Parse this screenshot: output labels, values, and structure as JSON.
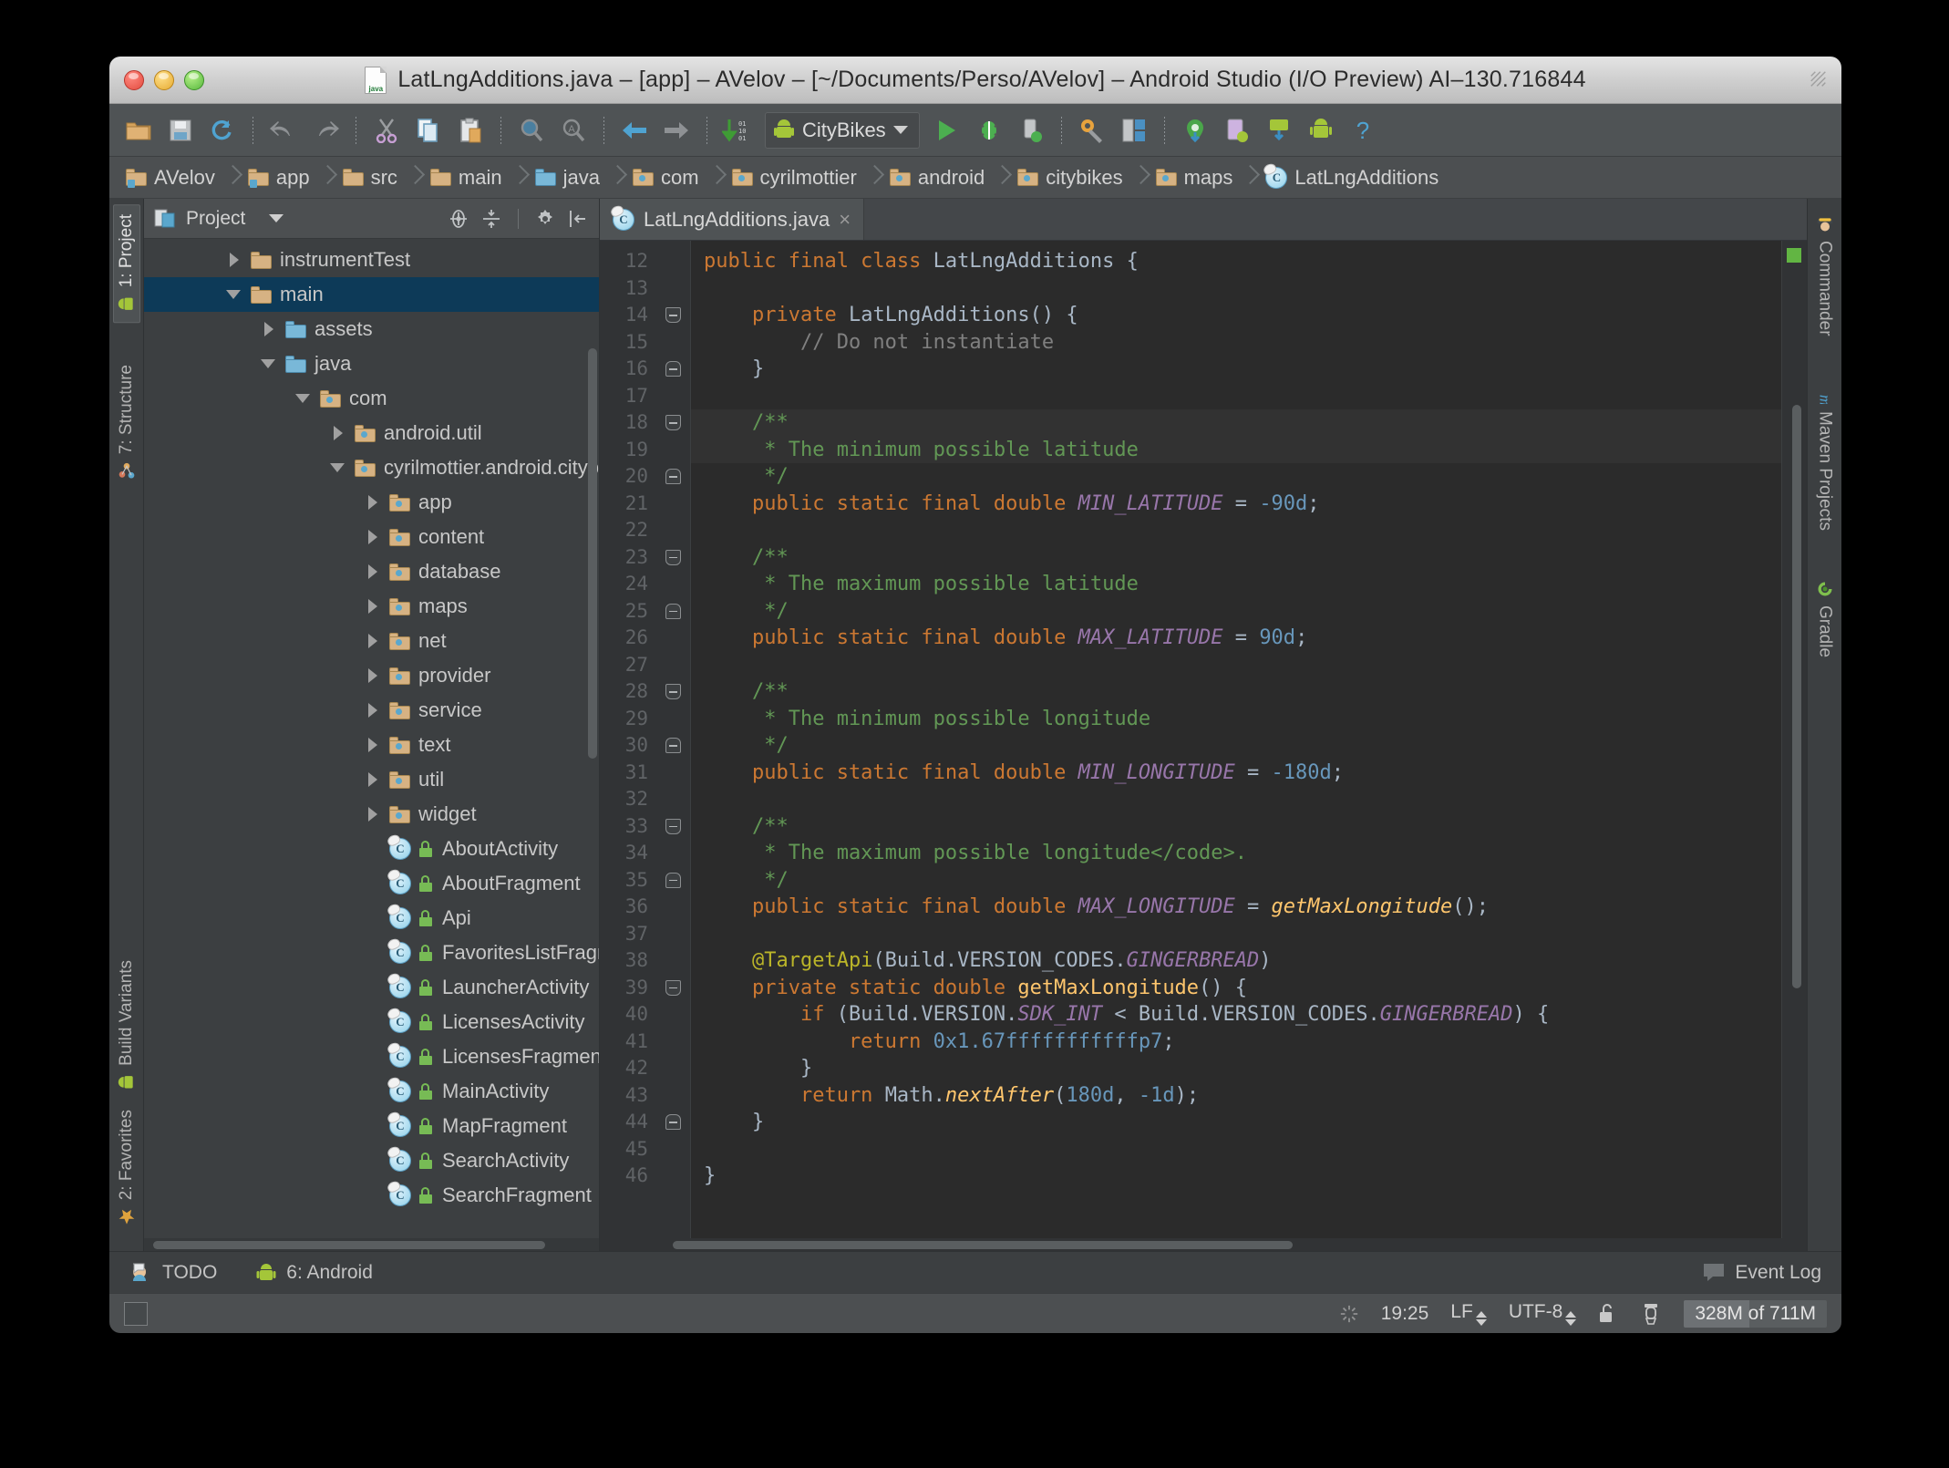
{
  "window": {
    "title": "LatLngAdditions.java – [app] – AVelov – [~/Documents/Perso/AVelov] – Android Studio (I/O Preview) AI–130.716844",
    "file_icon": "java-file-icon"
  },
  "toolbar": {
    "buttons": [
      {
        "name": "open-folder-icon"
      },
      {
        "name": "save-all-icon"
      },
      {
        "name": "sync-refresh-icon"
      },
      {
        "name": "separator"
      },
      {
        "name": "undo-icon"
      },
      {
        "name": "redo-icon"
      },
      {
        "name": "separator"
      },
      {
        "name": "cut-icon"
      },
      {
        "name": "copy-icon"
      },
      {
        "name": "paste-icon"
      },
      {
        "name": "separator"
      },
      {
        "name": "find-icon"
      },
      {
        "name": "replace-icon"
      },
      {
        "name": "separator"
      },
      {
        "name": "back-icon"
      },
      {
        "name": "forward-icon"
      },
      {
        "name": "separator"
      },
      {
        "name": "compile-icon"
      }
    ],
    "run_config": "CityBikes",
    "right_buttons": [
      {
        "name": "run-icon"
      },
      {
        "name": "debug-icon"
      },
      {
        "name": "attach-debugger-icon"
      },
      {
        "name": "separator"
      },
      {
        "name": "settings-wrench-icon"
      },
      {
        "name": "project-structure-icon"
      },
      {
        "name": "separator"
      },
      {
        "name": "sdk-location-icon"
      },
      {
        "name": "avd-manager-icon"
      },
      {
        "name": "sdk-manager-icon"
      },
      {
        "name": "android-icon"
      },
      {
        "name": "help-icon"
      }
    ]
  },
  "breadcrumbs": [
    {
      "label": "AVelov",
      "icon": "folder-source-icon"
    },
    {
      "label": "app",
      "icon": "folder-source-icon"
    },
    {
      "label": "src",
      "icon": "folder-icon"
    },
    {
      "label": "main",
      "icon": "folder-icon"
    },
    {
      "label": "java",
      "icon": "folder-blue-icon"
    },
    {
      "label": "com",
      "icon": "folder-package-icon"
    },
    {
      "label": "cyrilmottier",
      "icon": "folder-package-icon"
    },
    {
      "label": "android",
      "icon": "folder-package-icon"
    },
    {
      "label": "citybikes",
      "icon": "folder-package-icon"
    },
    {
      "label": "maps",
      "icon": "folder-package-icon"
    },
    {
      "label": "LatLngAdditions",
      "icon": "class-icon"
    }
  ],
  "left_strip": [
    {
      "label": "1: Project",
      "icon": "android-icon",
      "selected": true
    },
    {
      "label": "7: Structure",
      "icon": "structure-icon",
      "selected": false
    },
    {
      "label": "Build Variants",
      "icon": "android-icon",
      "selected": false
    },
    {
      "label": "2: Favorites",
      "icon": "star-icon",
      "selected": false
    }
  ],
  "right_strip": [
    {
      "label": "Commander",
      "icon": "commander-icon"
    },
    {
      "label": "Maven Projects",
      "icon": "maven-icon"
    },
    {
      "label": "Gradle",
      "icon": "gradle-icon"
    }
  ],
  "project_panel": {
    "title": "Project",
    "title_icon": "project-view-icon",
    "actions": [
      {
        "name": "scroll-from-source-icon"
      },
      {
        "name": "collapse-all-icon"
      },
      {
        "name": "settings-gear-icon"
      },
      {
        "name": "hide-panel-icon"
      }
    ],
    "tree": [
      {
        "label": "instrumentTest",
        "indent": 2,
        "state": "closed",
        "icon": "folder-icon",
        "selected": false
      },
      {
        "label": "main",
        "indent": 2,
        "state": "open",
        "icon": "folder-icon",
        "selected": true
      },
      {
        "label": "assets",
        "indent": 3,
        "state": "closed",
        "icon": "folder-blue-icon",
        "selected": false
      },
      {
        "label": "java",
        "indent": 3,
        "state": "open",
        "icon": "folder-blue-icon",
        "selected": false
      },
      {
        "label": "com",
        "indent": 4,
        "state": "open",
        "icon": "folder-package-icon",
        "selected": false
      },
      {
        "label": "android.util",
        "indent": 5,
        "state": "closed",
        "icon": "folder-package-icon",
        "selected": false
      },
      {
        "label": "cyrilmottier.android.citybikes",
        "indent": 5,
        "state": "open",
        "icon": "folder-package-icon",
        "selected": false
      },
      {
        "label": "app",
        "indent": 6,
        "state": "closed",
        "icon": "folder-package-icon",
        "selected": false
      },
      {
        "label": "content",
        "indent": 6,
        "state": "closed",
        "icon": "folder-package-icon",
        "selected": false
      },
      {
        "label": "database",
        "indent": 6,
        "state": "closed",
        "icon": "folder-package-icon",
        "selected": false
      },
      {
        "label": "maps",
        "indent": 6,
        "state": "closed",
        "icon": "folder-package-icon",
        "selected": false
      },
      {
        "label": "net",
        "indent": 6,
        "state": "closed",
        "icon": "folder-package-icon",
        "selected": false
      },
      {
        "label": "provider",
        "indent": 6,
        "state": "closed",
        "icon": "folder-package-icon",
        "selected": false
      },
      {
        "label": "service",
        "indent": 6,
        "state": "closed",
        "icon": "folder-package-icon",
        "selected": false
      },
      {
        "label": "text",
        "indent": 6,
        "state": "closed",
        "icon": "folder-package-icon",
        "selected": false
      },
      {
        "label": "util",
        "indent": 6,
        "state": "closed",
        "icon": "folder-package-icon",
        "selected": false
      },
      {
        "label": "widget",
        "indent": 6,
        "state": "closed",
        "icon": "folder-package-icon",
        "selected": false
      },
      {
        "label": "AboutActivity",
        "indent": 6,
        "state": "none",
        "icon": "class-icon",
        "selected": false
      },
      {
        "label": "AboutFragment",
        "indent": 6,
        "state": "none",
        "icon": "class-icon",
        "selected": false
      },
      {
        "label": "Api",
        "indent": 6,
        "state": "none",
        "icon": "class-icon",
        "selected": false
      },
      {
        "label": "FavoritesListFragment",
        "indent": 6,
        "state": "none",
        "icon": "class-icon",
        "selected": false
      },
      {
        "label": "LauncherActivity",
        "indent": 6,
        "state": "none",
        "icon": "class-icon",
        "selected": false
      },
      {
        "label": "LicensesActivity",
        "indent": 6,
        "state": "none",
        "icon": "class-icon",
        "selected": false
      },
      {
        "label": "LicensesFragment",
        "indent": 6,
        "state": "none",
        "icon": "class-icon",
        "selected": false
      },
      {
        "label": "MainActivity",
        "indent": 6,
        "state": "none",
        "icon": "class-icon",
        "selected": false
      },
      {
        "label": "MapFragment",
        "indent": 6,
        "state": "none",
        "icon": "class-icon",
        "selected": false
      },
      {
        "label": "SearchActivity",
        "indent": 6,
        "state": "none",
        "icon": "class-icon",
        "selected": false
      },
      {
        "label": "SearchFragment",
        "indent": 6,
        "state": "none",
        "icon": "class-icon",
        "selected": false
      }
    ]
  },
  "editor": {
    "tab": {
      "label": "LatLngAdditions.java",
      "icon": "class-icon",
      "close": "×"
    },
    "first_line": 12,
    "lines": [
      {
        "n": 12,
        "fold": "none",
        "hl": false,
        "tokens": [
          {
            "t": "public final class ",
            "c": "kw"
          },
          {
            "t": "LatLngAdditions {",
            "c": "cls"
          }
        ]
      },
      {
        "n": 13,
        "fold": "none",
        "hl": false,
        "tokens": []
      },
      {
        "n": 14,
        "fold": "collapse",
        "hl": false,
        "tokens": [
          {
            "t": "    ",
            "c": "cls"
          },
          {
            "t": "private ",
            "c": "kw"
          },
          {
            "t": "LatLngAdditions() {",
            "c": "cls"
          }
        ]
      },
      {
        "n": 15,
        "fold": "none",
        "hl": false,
        "tokens": [
          {
            "t": "        // Do not instantiate",
            "c": "cmt"
          }
        ]
      },
      {
        "n": 16,
        "fold": "expandtop",
        "hl": false,
        "tokens": [
          {
            "t": "    }",
            "c": "cls"
          }
        ]
      },
      {
        "n": 17,
        "fold": "none",
        "hl": false,
        "tokens": []
      },
      {
        "n": 18,
        "fold": "collapse",
        "hl": true,
        "tokens": [
          {
            "t": "    /**",
            "c": "doc"
          }
        ]
      },
      {
        "n": 19,
        "fold": "none",
        "hl": true,
        "tokens": [
          {
            "t": "     * The minimum possible latitude",
            "c": "doc"
          }
        ]
      },
      {
        "n": 20,
        "fold": "expandtop",
        "hl": false,
        "tokens": [
          {
            "t": "     */",
            "c": "doc"
          }
        ]
      },
      {
        "n": 21,
        "fold": "none",
        "hl": false,
        "tokens": [
          {
            "t": "    public static final double ",
            "c": "kw"
          },
          {
            "t": "MIN_LATITUDE",
            "c": "const"
          },
          {
            "t": " = ",
            "c": "cls"
          },
          {
            "t": "-90d",
            "c": "num"
          },
          {
            "t": ";",
            "c": "cls"
          }
        ]
      },
      {
        "n": 22,
        "fold": "none",
        "hl": false,
        "tokens": []
      },
      {
        "n": 23,
        "fold": "collapse",
        "hl": false,
        "tokens": [
          {
            "t": "    /**",
            "c": "doc"
          }
        ]
      },
      {
        "n": 24,
        "fold": "none",
        "hl": false,
        "tokens": [
          {
            "t": "     * The maximum possible latitude",
            "c": "doc"
          }
        ]
      },
      {
        "n": 25,
        "fold": "expandtop",
        "hl": false,
        "tokens": [
          {
            "t": "     */",
            "c": "doc"
          }
        ]
      },
      {
        "n": 26,
        "fold": "none",
        "hl": false,
        "tokens": [
          {
            "t": "    public static final double ",
            "c": "kw"
          },
          {
            "t": "MAX_LATITUDE",
            "c": "const"
          },
          {
            "t": " = ",
            "c": "cls"
          },
          {
            "t": "90d",
            "c": "num"
          },
          {
            "t": ";",
            "c": "cls"
          }
        ]
      },
      {
        "n": 27,
        "fold": "none",
        "hl": false,
        "tokens": []
      },
      {
        "n": 28,
        "fold": "collapse",
        "hl": false,
        "tokens": [
          {
            "t": "    /**",
            "c": "doc"
          }
        ]
      },
      {
        "n": 29,
        "fold": "none",
        "hl": false,
        "tokens": [
          {
            "t": "     * The minimum possible longitude",
            "c": "doc"
          }
        ]
      },
      {
        "n": 30,
        "fold": "expandtop",
        "hl": false,
        "tokens": [
          {
            "t": "     */",
            "c": "doc"
          }
        ]
      },
      {
        "n": 31,
        "fold": "none",
        "hl": false,
        "tokens": [
          {
            "t": "    public static final double ",
            "c": "kw"
          },
          {
            "t": "MIN_LONGITUDE",
            "c": "const"
          },
          {
            "t": " = ",
            "c": "cls"
          },
          {
            "t": "-180d",
            "c": "num"
          },
          {
            "t": ";",
            "c": "cls"
          }
        ]
      },
      {
        "n": 32,
        "fold": "none",
        "hl": false,
        "tokens": []
      },
      {
        "n": 33,
        "fold": "collapse",
        "hl": false,
        "tokens": [
          {
            "t": "    /**",
            "c": "doc"
          }
        ]
      },
      {
        "n": 34,
        "fold": "none",
        "hl": false,
        "tokens": [
          {
            "t": "     * The maximum possible longitude</code>.",
            "c": "doc"
          }
        ]
      },
      {
        "n": 35,
        "fold": "expandtop",
        "hl": false,
        "tokens": [
          {
            "t": "     */",
            "c": "doc"
          }
        ]
      },
      {
        "n": 36,
        "fold": "none",
        "hl": false,
        "tokens": [
          {
            "t": "    public static final double ",
            "c": "kw"
          },
          {
            "t": "MAX_LONGITUDE",
            "c": "const"
          },
          {
            "t": " = ",
            "c": "cls"
          },
          {
            "t": "getMaxLongitude",
            "c": "meth"
          },
          {
            "t": "();",
            "c": "cls"
          }
        ]
      },
      {
        "n": 37,
        "fold": "none",
        "hl": false,
        "tokens": []
      },
      {
        "n": 38,
        "fold": "none",
        "hl": false,
        "tokens": [
          {
            "t": "    @TargetApi",
            "c": "anno"
          },
          {
            "t": "(Build.VERSION_CODES.",
            "c": "cls"
          },
          {
            "t": "GINGERBREAD",
            "c": "const"
          },
          {
            "t": ")",
            "c": "cls"
          }
        ]
      },
      {
        "n": 39,
        "fold": "collapse",
        "hl": false,
        "tokens": [
          {
            "t": "    private static double ",
            "c": "kw"
          },
          {
            "t": "getMaxLongitude",
            "c": "methd"
          },
          {
            "t": "() {",
            "c": "cls"
          }
        ]
      },
      {
        "n": 40,
        "fold": "none",
        "hl": false,
        "tokens": [
          {
            "t": "        if ",
            "c": "kw"
          },
          {
            "t": "(Build.VERSION.",
            "c": "cls"
          },
          {
            "t": "SDK_INT",
            "c": "const"
          },
          {
            "t": " < Build.VERSION_CODES.",
            "c": "cls"
          },
          {
            "t": "GINGERBREAD",
            "c": "const"
          },
          {
            "t": ") {",
            "c": "cls"
          }
        ]
      },
      {
        "n": 41,
        "fold": "none",
        "hl": false,
        "tokens": [
          {
            "t": "            return ",
            "c": "kw"
          },
          {
            "t": "0x1.67fffffffffffp7",
            "c": "num"
          },
          {
            "t": ";",
            "c": "cls"
          }
        ]
      },
      {
        "n": 42,
        "fold": "none",
        "hl": false,
        "tokens": [
          {
            "t": "        }",
            "c": "cls"
          }
        ]
      },
      {
        "n": 43,
        "fold": "none",
        "hl": false,
        "tokens": [
          {
            "t": "        return ",
            "c": "kw"
          },
          {
            "t": "Math.",
            "c": "cls"
          },
          {
            "t": "nextAfter",
            "c": "meth"
          },
          {
            "t": "(",
            "c": "cls"
          },
          {
            "t": "180d",
            "c": "num"
          },
          {
            "t": ", ",
            "c": "cls"
          },
          {
            "t": "-1d",
            "c": "num"
          },
          {
            "t": ");",
            "c": "cls"
          }
        ]
      },
      {
        "n": 44,
        "fold": "expandtop",
        "hl": false,
        "tokens": [
          {
            "t": "    }",
            "c": "cls"
          }
        ]
      },
      {
        "n": 45,
        "fold": "none",
        "hl": false,
        "tokens": []
      },
      {
        "n": 46,
        "fold": "none",
        "hl": false,
        "tokens": [
          {
            "t": "}",
            "c": "cls"
          }
        ]
      }
    ]
  },
  "bottom_bar": {
    "items": [
      {
        "label": "TODO",
        "icon": "todo-icon"
      },
      {
        "label": "6: Android",
        "icon": "android-icon"
      }
    ],
    "event_log": {
      "label": "Event Log",
      "icon": "event-log-icon"
    }
  },
  "status_bar": {
    "time": "19:25",
    "line_separator": "LF",
    "encoding": "UTF-8",
    "lock_icon": "unlock-icon",
    "hector_icon": "hector-icon",
    "memory": "328M of 711M",
    "memory_used_pct": 46,
    "spinner_icon": "background-tasks-icon",
    "toggle_icon": "status-toggle-icon"
  },
  "colors": {
    "selection": "#0d3a58",
    "editor_bg": "#2b2b2b",
    "panel_bg": "#3c3f41",
    "keyword": "#cc7832",
    "doc_comment": "#629755",
    "constant": "#9876aa",
    "number": "#6897bb",
    "annotation": "#bbb529",
    "method": "#ffc66d",
    "default_text": "#a9b7c6",
    "ok_marker": "#62b543"
  }
}
